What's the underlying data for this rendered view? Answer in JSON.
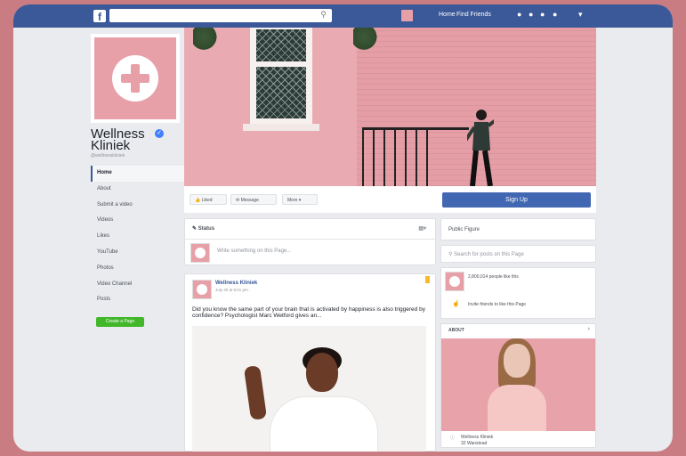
{
  "topbar": {
    "fb_logo": "f",
    "search_icon": "search-icon",
    "links": [
      "Home",
      "Find Friends"
    ],
    "icons": [
      "friend-requests-icon",
      "messages-icon",
      "notifications-icon",
      "help-icon",
      "dropdown-icon"
    ]
  },
  "page": {
    "name": "Wellness Kliniek",
    "handle": "@wellnesskliniek",
    "verified": true
  },
  "nav": {
    "items": [
      "Home",
      "About",
      "Submit a video",
      "Videos",
      "Likes",
      "YouTube",
      "Photos",
      "Video Channel",
      "Posts"
    ],
    "active": "Home",
    "create_page": "Create a Page"
  },
  "actions": {
    "like": "Liked",
    "message": "Message",
    "more": "More",
    "signup": "Sign Up"
  },
  "composer": {
    "tab": "Status",
    "placeholder": "Write something on this Page..."
  },
  "post": {
    "author": "Wellness Kliniek",
    "meta": "July 30 at 8:01 pm · ",
    "text": "Did you know the same part of your brain that is activated by happiness is also triggered by confidence? Psychologist Marc Wetford gives an..."
  },
  "sidebar": {
    "category": "Public Figure",
    "search_placeholder": "Search for posts on this Page",
    "likes_text": "2,800,014 people like this",
    "invite_text": "Invite friends to like this Page",
    "about_label": "ABOUT",
    "about_item_1": "Wellness Kliniek",
    "about_item_2": "32 Wanstead"
  },
  "colors": {
    "brand": "#3b5998",
    "accent": "#4267b2",
    "pink": "#e8a0a8",
    "green": "#42b72a"
  }
}
